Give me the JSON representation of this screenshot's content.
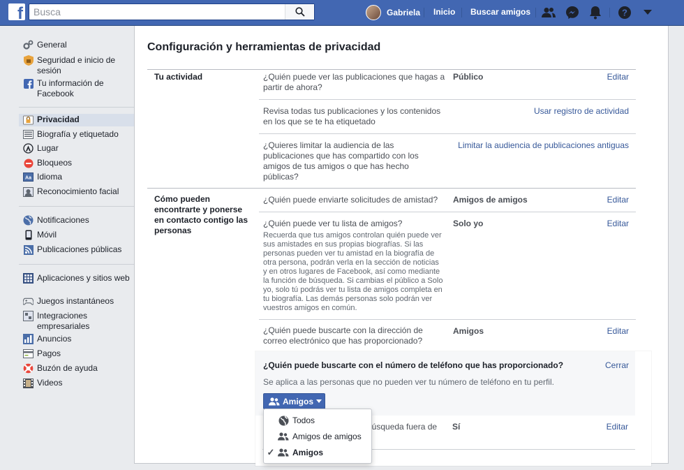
{
  "topbar": {
    "logo": "f",
    "search_placeholder": "Busca",
    "user_name": "Gabriela",
    "nav_home": "Inicio",
    "nav_find_friends": "Buscar amigos",
    "brand_color": "#4267b2",
    "icons": [
      "search-icon",
      "friend-requests-icon",
      "messenger-icon",
      "notifications-icon",
      "help-icon",
      "account-menu-icon"
    ]
  },
  "sidebar": {
    "groups": [
      [
        {
          "label": "General",
          "icon": "gears-icon"
        },
        {
          "label": "Seguridad e inicio de sesión",
          "icon": "shield-icon"
        },
        {
          "label": "Tu información de Facebook",
          "icon": "facebook-icon"
        }
      ],
      [
        {
          "label": "Privacidad",
          "icon": "lock-icon",
          "active": true
        },
        {
          "label": "Biografía y etiquetado",
          "icon": "timeline-icon"
        },
        {
          "label": "Lugar",
          "icon": "location-icon"
        },
        {
          "label": "Bloqueos",
          "icon": "block-icon"
        },
        {
          "label": "Idioma",
          "icon": "language-icon"
        },
        {
          "label": "Reconocimiento facial",
          "icon": "face-icon"
        }
      ],
      [
        {
          "label": "Notificaciones",
          "icon": "globe-icon"
        },
        {
          "label": "Móvil",
          "icon": "mobile-icon"
        },
        {
          "label": "Publicaciones públicas",
          "icon": "rss-icon"
        }
      ],
      [
        {
          "label": "Aplicaciones y sitios web",
          "icon": "apps-icon"
        },
        {
          "label": "Juegos instantáneos",
          "icon": "gamepad-icon"
        },
        {
          "label": "Integraciones empresariales",
          "icon": "integrations-icon"
        },
        {
          "label": "Anuncios",
          "icon": "ads-icon"
        },
        {
          "label": "Pagos",
          "icon": "payments-icon"
        },
        {
          "label": "Buzón de ayuda",
          "icon": "lifebuoy-icon"
        },
        {
          "label": "Videos",
          "icon": "film-icon"
        }
      ]
    ]
  },
  "main": {
    "title": "Configuración y herramientas de privacidad",
    "sections": [
      {
        "label": "Tu actividad",
        "rows": [
          {
            "question": "¿Quién puede ver las publicaciones que hagas a partir de ahora?",
            "value": "Público",
            "action": "Editar"
          },
          {
            "question": "Revisa todas tus publicaciones y los contenidos en los que se te ha etiquetado",
            "value": "",
            "action": "Usar registro de actividad"
          },
          {
            "question": "¿Quieres limitar la audiencia de las publicaciones que has compartido con los amigos de tus amigos o que has hecho públicas?",
            "value": "",
            "action": "Limitar la audiencia de publicaciones antiguas"
          }
        ]
      },
      {
        "label": "Cómo pueden encontrarte y ponerse en contacto contigo las personas",
        "rows": [
          {
            "question": "¿Quién puede enviarte solicitudes de amistad?",
            "value": "Amigos de amigos",
            "action": "Editar"
          },
          {
            "question": "¿Quién puede ver tu lista de amigos?",
            "note": "Recuerda que tus amigos controlan quién puede ver sus amistades en sus propias biografías. Si las personas pueden ver tu amistad en la biografía de otra persona, podrán verla en la sección de noticias y en otros lugares de Facebook, así como mediante la función de búsqueda. Si cambias el público a Solo yo, solo tú podrás ver tu lista de amigos completa en tu biografía. Las demás personas solo podrán ver vuestros amigos en común.",
            "value": "Solo yo",
            "action": "Editar"
          },
          {
            "question": "¿Quién puede buscarte con la dirección de correo electrónico que has proporcionado?",
            "value": "Amigos",
            "action": "Editar"
          },
          {
            "question": "búsqueda fuera de",
            "value": "Sí",
            "action": "Editar"
          }
        ]
      }
    ],
    "expanded": {
      "title": "¿Quién puede buscarte con el número de teléfono que has proporcionado?",
      "close": "Cerrar",
      "description": "Se aplica a las personas que no pueden ver tu número de teléfono en tu perfil.",
      "audience_button": "Amigos"
    },
    "dropdown": {
      "options": [
        {
          "label": "Todos",
          "icon": "globe-icon",
          "selected": false
        },
        {
          "label": "Amigos de amigos",
          "icon": "friends-icon",
          "selected": false
        },
        {
          "label": "Amigos",
          "icon": "friends-icon",
          "selected": true
        }
      ],
      "checkmark": "✓"
    }
  }
}
